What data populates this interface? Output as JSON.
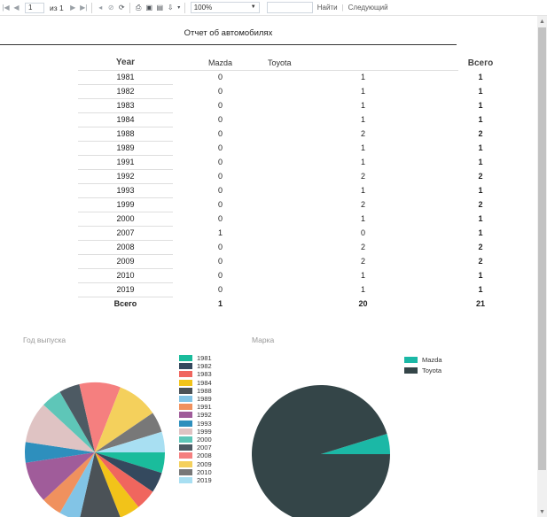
{
  "toolbar": {
    "page_value": "1",
    "of_label": "из 1",
    "zoom_value": "100%",
    "find_label": "Найти",
    "next_label": "Следующий",
    "icons": [
      "first-page-icon",
      "prev-page-icon",
      "next-page-icon",
      "last-page-icon",
      "back-icon",
      "stop-icon",
      "refresh-icon",
      "print-icon",
      "print-layout-icon",
      "page-setup-icon",
      "export-icon"
    ]
  },
  "report": {
    "title": "Отчет об автомобилях",
    "header": {
      "year": "Year",
      "mazda": "Mazda",
      "toyota": "Toyota",
      "total": "Всего"
    },
    "rows": [
      [
        "1981",
        "0",
        "1",
        "1"
      ],
      [
        "1982",
        "0",
        "1",
        "1"
      ],
      [
        "1983",
        "0",
        "1",
        "1"
      ],
      [
        "1984",
        "0",
        "1",
        "1"
      ],
      [
        "1988",
        "0",
        "2",
        "2"
      ],
      [
        "1989",
        "0",
        "1",
        "1"
      ],
      [
        "1991",
        "0",
        "1",
        "1"
      ],
      [
        "1992",
        "0",
        "2",
        "2"
      ],
      [
        "1993",
        "0",
        "1",
        "1"
      ],
      [
        "1999",
        "0",
        "2",
        "2"
      ],
      [
        "2000",
        "0",
        "1",
        "1"
      ],
      [
        "2007",
        "1",
        "0",
        "1"
      ],
      [
        "2008",
        "0",
        "2",
        "2"
      ],
      [
        "2009",
        "0",
        "2",
        "2"
      ],
      [
        "2010",
        "0",
        "1",
        "1"
      ],
      [
        "2019",
        "0",
        "1",
        "1"
      ]
    ],
    "total_row": [
      "Всего",
      "1",
      "20",
      "21"
    ]
  },
  "chart_data": [
    {
      "type": "pie",
      "title": "Год выпуска",
      "categories": [
        "1981",
        "1982",
        "1983",
        "1984",
        "1988",
        "1989",
        "1991",
        "1992",
        "1993",
        "1999",
        "2000",
        "2007",
        "2008",
        "2009",
        "2010",
        "2019"
      ],
      "values": [
        1,
        1,
        1,
        1,
        2,
        1,
        1,
        2,
        1,
        2,
        1,
        1,
        2,
        2,
        1,
        1
      ],
      "colors": [
        "#1abc9c",
        "#34495e",
        "#f0665e",
        "#f2c319",
        "#4b5257",
        "#82c4e6",
        "#f0915e",
        "#a05c9a",
        "#2e8fbd",
        "#dfc3c3",
        "#5ec6b8",
        "#4d5a63",
        "#f57f7f",
        "#f4d05c",
        "#787878",
        "#a8dff2"
      ],
      "legend": "right"
    },
    {
      "type": "pie",
      "title": "Марка",
      "categories": [
        "Mazda",
        "Toyota"
      ],
      "values": [
        1,
        20
      ],
      "colors": [
        "#1bb8a6",
        "#344548"
      ],
      "legend": "right"
    }
  ]
}
